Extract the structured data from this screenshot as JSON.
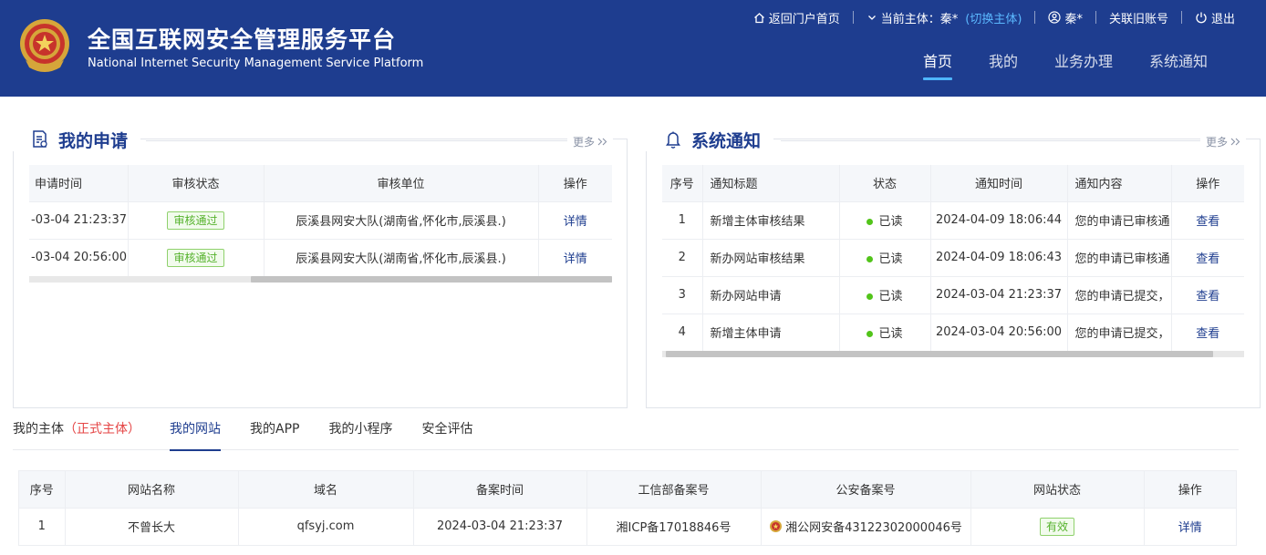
{
  "header": {
    "title_cn": "全国互联网安全管理服务平台",
    "title_en": "National Internet Security Management Service Platform",
    "topbar": {
      "home_link": "返回门户首页",
      "current_subject_label": "当前主体：秦*",
      "switch_subject": "(切换主体)",
      "user": "秦*",
      "link_old_account": "关联旧账号",
      "logout": "退出"
    },
    "nav": [
      {
        "label": "首页",
        "active": true
      },
      {
        "label": "我的",
        "active": false
      },
      {
        "label": "业务办理",
        "active": false
      },
      {
        "label": "系统通知",
        "active": false
      }
    ]
  },
  "applications": {
    "title": "我的申请",
    "more": "更多",
    "columns": [
      "申请时间",
      "审核状态",
      "审核单位",
      "操作"
    ],
    "rows": [
      {
        "time": "-03-04 21:23:37",
        "status": "审核通过",
        "unit": "辰溪县网安大队(湖南省,怀化市,辰溪县.)",
        "action": "详情"
      },
      {
        "time": "-03-04 20:56:00",
        "status": "审核通过",
        "unit": "辰溪县网安大队(湖南省,怀化市,辰溪县.)",
        "action": "详情"
      }
    ]
  },
  "notices": {
    "title": "系统通知",
    "more": "更多",
    "columns": [
      "序号",
      "通知标题",
      "状态",
      "通知时间",
      "通知内容",
      "操作"
    ],
    "rows": [
      {
        "no": "1",
        "title": "新增主体审核结果",
        "status": "已读",
        "time": "2024-04-09 18:06:44",
        "content": "您的申请已审核通",
        "action": "查看"
      },
      {
        "no": "2",
        "title": "新办网站审核结果",
        "status": "已读",
        "time": "2024-04-09 18:06:43",
        "content": "您的申请已审核通",
        "action": "查看"
      },
      {
        "no": "3",
        "title": "新办网站申请",
        "status": "已读",
        "time": "2024-03-04 21:23:37",
        "content": "您的申请已提交，",
        "action": "查看"
      },
      {
        "no": "4",
        "title": "新增主体申请",
        "status": "已读",
        "time": "2024-03-04 20:56:00",
        "content": "您的申请已提交，",
        "action": "查看"
      }
    ]
  },
  "tabs": {
    "subject": "我的主体",
    "subject_flag": "（正式主体）",
    "items": [
      "我的网站",
      "我的APP",
      "我的小程序",
      "安全评估"
    ]
  },
  "sites": {
    "columns": [
      "序号",
      "网站名称",
      "域名",
      "备案时间",
      "工信部备案号",
      "公安备案号",
      "网站状态",
      "操作"
    ],
    "rows": [
      {
        "no": "1",
        "name": "不曾长大",
        "domain": "qfsyj.com",
        "time": "2024-03-04 21:23:37",
        "icp": "湘ICP备17018846号",
        "police": "湘公网安备43122302000046号",
        "status": "有效",
        "action": "详情"
      }
    ]
  },
  "colors": {
    "brand": "#1e3d8f",
    "accent": "#4fb6ff",
    "success": "#52c41a",
    "warning_red": "#e54545"
  },
  "icons": [
    "emblem-icon",
    "home-icon",
    "chevron-down-icon",
    "user-icon",
    "power-icon",
    "document-icon",
    "bell-icon",
    "double-chevron-right-icon",
    "police-badge-icon"
  ]
}
